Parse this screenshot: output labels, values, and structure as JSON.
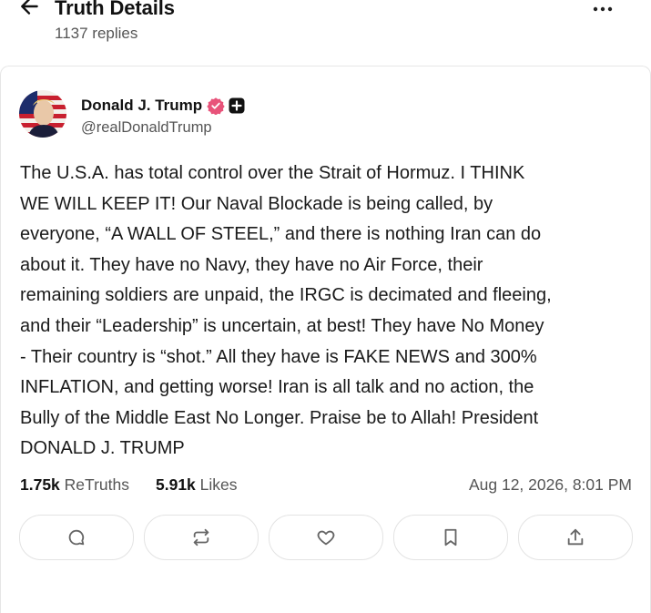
{
  "header": {
    "title": "Truth Details",
    "replies": "1137 replies",
    "back_icon": "arrow-left-icon",
    "more_icon": "more-horizontal-icon"
  },
  "post": {
    "author": {
      "display_name": "Donald J. Trump",
      "handle": "@realDonaldTrump",
      "verified_color": "#e8537a"
    },
    "text": "The U.S.A. has total control over the Strait of Hormuz. I THINK\nWE WILL KEEP IT! Our Naval Blockade is being called, by\neveryone, “A WALL OF STEEL,” and there is nothing Iran can do\nabout it. They have no Navy, they have no Air Force, their\nremaining soldiers are unpaid, the IRGC is decimated and fleeing,\nand their “Leadership” is uncertain, at best! They have No Money\n- Their country is “shot.” All they have is FAKE NEWS and 300%\nINFLATION, and getting worse! Iran is all talk and no action, the\nBully of the Middle East No Longer. Praise be to Allah! President\nDONALD J. TRUMP",
    "stats": {
      "retruths_count": "1.75k",
      "retruths_label": "ReTruths",
      "likes_count": "5.91k",
      "likes_label": "Likes"
    },
    "timestamp": "Aug 12, 2026, 8:01 PM",
    "actions": [
      "reply-icon",
      "retruth-icon",
      "like-icon",
      "bookmark-icon",
      "share-icon"
    ]
  }
}
